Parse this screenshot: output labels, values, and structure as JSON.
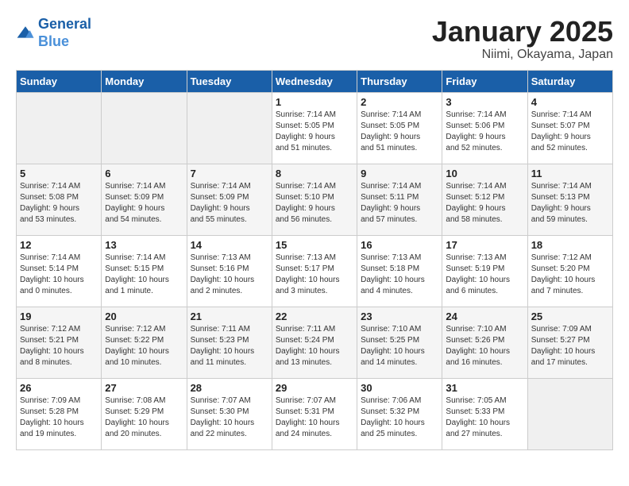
{
  "header": {
    "logo_line1": "General",
    "logo_line2": "Blue",
    "title": "January 2025",
    "subtitle": "Niimi, Okayama, Japan"
  },
  "days_of_week": [
    "Sunday",
    "Monday",
    "Tuesday",
    "Wednesday",
    "Thursday",
    "Friday",
    "Saturday"
  ],
  "weeks": [
    [
      {
        "day": "",
        "info": ""
      },
      {
        "day": "",
        "info": ""
      },
      {
        "day": "",
        "info": ""
      },
      {
        "day": "1",
        "info": "Sunrise: 7:14 AM\nSunset: 5:05 PM\nDaylight: 9 hours\nand 51 minutes."
      },
      {
        "day": "2",
        "info": "Sunrise: 7:14 AM\nSunset: 5:05 PM\nDaylight: 9 hours\nand 51 minutes."
      },
      {
        "day": "3",
        "info": "Sunrise: 7:14 AM\nSunset: 5:06 PM\nDaylight: 9 hours\nand 52 minutes."
      },
      {
        "day": "4",
        "info": "Sunrise: 7:14 AM\nSunset: 5:07 PM\nDaylight: 9 hours\nand 52 minutes."
      }
    ],
    [
      {
        "day": "5",
        "info": "Sunrise: 7:14 AM\nSunset: 5:08 PM\nDaylight: 9 hours\nand 53 minutes."
      },
      {
        "day": "6",
        "info": "Sunrise: 7:14 AM\nSunset: 5:09 PM\nDaylight: 9 hours\nand 54 minutes."
      },
      {
        "day": "7",
        "info": "Sunrise: 7:14 AM\nSunset: 5:09 PM\nDaylight: 9 hours\nand 55 minutes."
      },
      {
        "day": "8",
        "info": "Sunrise: 7:14 AM\nSunset: 5:10 PM\nDaylight: 9 hours\nand 56 minutes."
      },
      {
        "day": "9",
        "info": "Sunrise: 7:14 AM\nSunset: 5:11 PM\nDaylight: 9 hours\nand 57 minutes."
      },
      {
        "day": "10",
        "info": "Sunrise: 7:14 AM\nSunset: 5:12 PM\nDaylight: 9 hours\nand 58 minutes."
      },
      {
        "day": "11",
        "info": "Sunrise: 7:14 AM\nSunset: 5:13 PM\nDaylight: 9 hours\nand 59 minutes."
      }
    ],
    [
      {
        "day": "12",
        "info": "Sunrise: 7:14 AM\nSunset: 5:14 PM\nDaylight: 10 hours\nand 0 minutes."
      },
      {
        "day": "13",
        "info": "Sunrise: 7:14 AM\nSunset: 5:15 PM\nDaylight: 10 hours\nand 1 minute."
      },
      {
        "day": "14",
        "info": "Sunrise: 7:13 AM\nSunset: 5:16 PM\nDaylight: 10 hours\nand 2 minutes."
      },
      {
        "day": "15",
        "info": "Sunrise: 7:13 AM\nSunset: 5:17 PM\nDaylight: 10 hours\nand 3 minutes."
      },
      {
        "day": "16",
        "info": "Sunrise: 7:13 AM\nSunset: 5:18 PM\nDaylight: 10 hours\nand 4 minutes."
      },
      {
        "day": "17",
        "info": "Sunrise: 7:13 AM\nSunset: 5:19 PM\nDaylight: 10 hours\nand 6 minutes."
      },
      {
        "day": "18",
        "info": "Sunrise: 7:12 AM\nSunset: 5:20 PM\nDaylight: 10 hours\nand 7 minutes."
      }
    ],
    [
      {
        "day": "19",
        "info": "Sunrise: 7:12 AM\nSunset: 5:21 PM\nDaylight: 10 hours\nand 8 minutes."
      },
      {
        "day": "20",
        "info": "Sunrise: 7:12 AM\nSunset: 5:22 PM\nDaylight: 10 hours\nand 10 minutes."
      },
      {
        "day": "21",
        "info": "Sunrise: 7:11 AM\nSunset: 5:23 PM\nDaylight: 10 hours\nand 11 minutes."
      },
      {
        "day": "22",
        "info": "Sunrise: 7:11 AM\nSunset: 5:24 PM\nDaylight: 10 hours\nand 13 minutes."
      },
      {
        "day": "23",
        "info": "Sunrise: 7:10 AM\nSunset: 5:25 PM\nDaylight: 10 hours\nand 14 minutes."
      },
      {
        "day": "24",
        "info": "Sunrise: 7:10 AM\nSunset: 5:26 PM\nDaylight: 10 hours\nand 16 minutes."
      },
      {
        "day": "25",
        "info": "Sunrise: 7:09 AM\nSunset: 5:27 PM\nDaylight: 10 hours\nand 17 minutes."
      }
    ],
    [
      {
        "day": "26",
        "info": "Sunrise: 7:09 AM\nSunset: 5:28 PM\nDaylight: 10 hours\nand 19 minutes."
      },
      {
        "day": "27",
        "info": "Sunrise: 7:08 AM\nSunset: 5:29 PM\nDaylight: 10 hours\nand 20 minutes."
      },
      {
        "day": "28",
        "info": "Sunrise: 7:07 AM\nSunset: 5:30 PM\nDaylight: 10 hours\nand 22 minutes."
      },
      {
        "day": "29",
        "info": "Sunrise: 7:07 AM\nSunset: 5:31 PM\nDaylight: 10 hours\nand 24 minutes."
      },
      {
        "day": "30",
        "info": "Sunrise: 7:06 AM\nSunset: 5:32 PM\nDaylight: 10 hours\nand 25 minutes."
      },
      {
        "day": "31",
        "info": "Sunrise: 7:05 AM\nSunset: 5:33 PM\nDaylight: 10 hours\nand 27 minutes."
      },
      {
        "day": "",
        "info": ""
      }
    ]
  ]
}
